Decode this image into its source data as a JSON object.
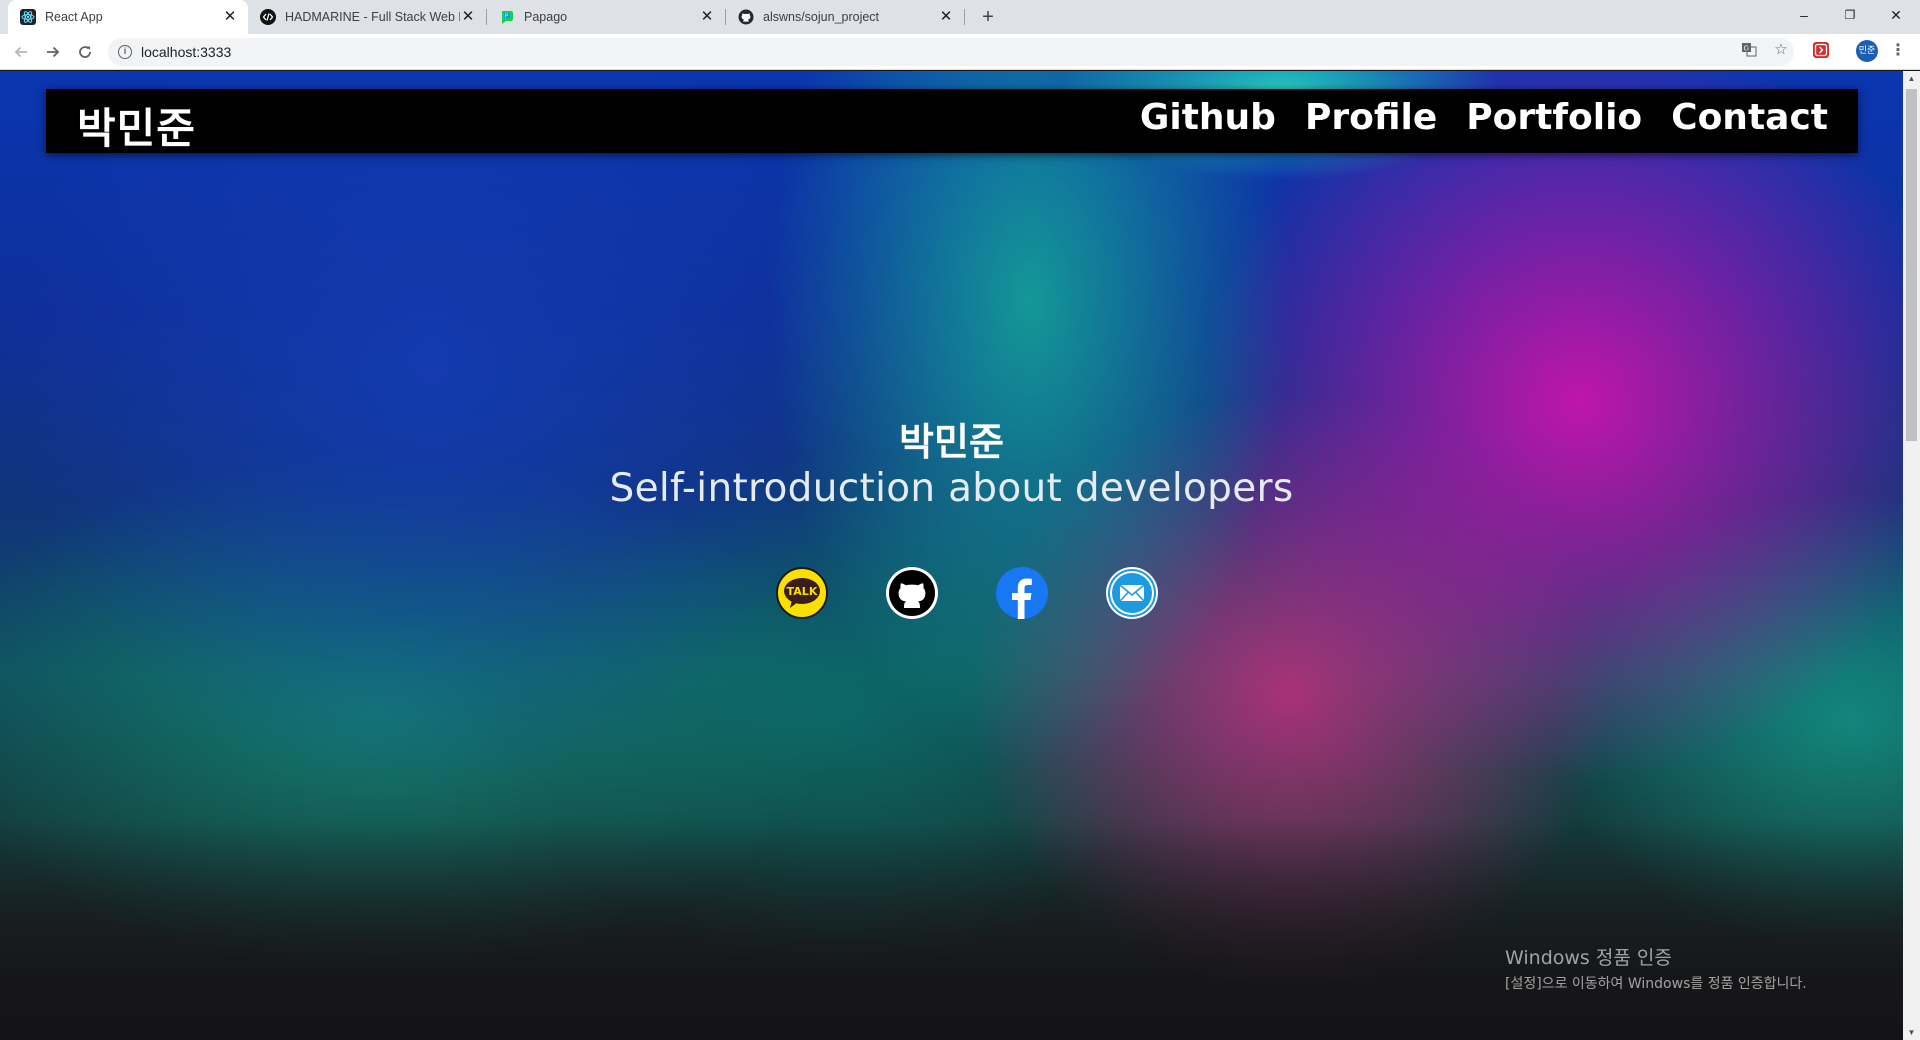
{
  "browser": {
    "tabs": [
      {
        "title": "React App",
        "active": true,
        "favicon": "react-atom-icon"
      },
      {
        "title": "HADMARINE - Full Stack Web D",
        "active": false,
        "favicon": "code-brackets-icon"
      },
      {
        "title": "Papago",
        "active": false,
        "favicon": "papago-icon"
      },
      {
        "title": "alswns/sojun_project",
        "active": false,
        "favicon": "github-icon"
      }
    ],
    "new_tab_label": "+",
    "url": "localhost:3333",
    "profile_label": "민준",
    "window_controls": {
      "minimize": "–",
      "maximize": "❐",
      "close": "✕"
    }
  },
  "page": {
    "brand": "박민준",
    "nav": [
      "Github",
      "Profile",
      "Portfolio",
      "Contact"
    ],
    "hero": {
      "name": "박민준",
      "subtitle": "Self-introduction about developers"
    },
    "socials": [
      {
        "name": "kakaotalk",
        "label": "TALK",
        "color": "#f9e000"
      },
      {
        "name": "github",
        "color": "#000000"
      },
      {
        "name": "facebook",
        "color": "#1877f2"
      },
      {
        "name": "email",
        "color": "#1e9be0"
      }
    ]
  },
  "os_overlay": {
    "title": "Windows 정품 인증",
    "subtitle": "[설정]으로 이동하여 Windows를 정품 인증합니다."
  },
  "colors": {
    "navbar_bg": "#000000",
    "tabstrip_bg": "#dee1e6",
    "kakao_yellow": "#f9e000",
    "facebook_blue": "#1877f2"
  }
}
